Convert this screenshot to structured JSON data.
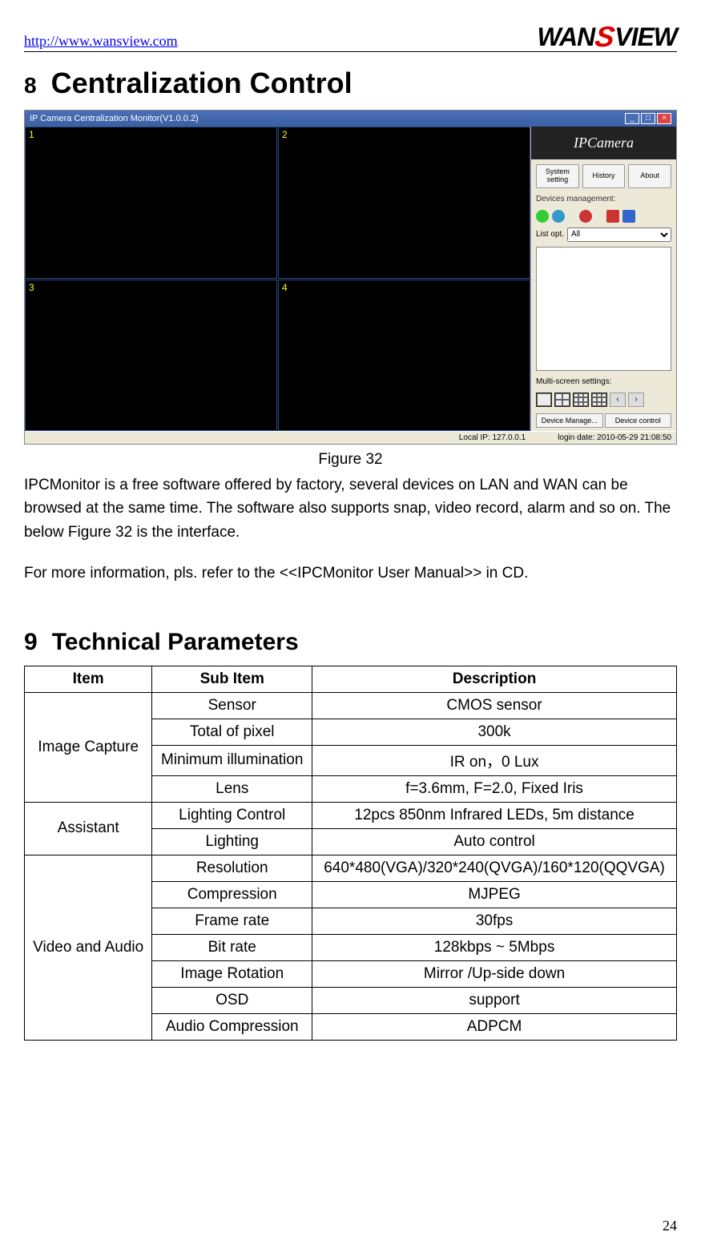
{
  "header": {
    "url": "http://www.wansview.com",
    "logo_text": "WANSVIEW",
    "logo_s": "S"
  },
  "section8": {
    "num": "8",
    "title": "Centralization Control"
  },
  "app": {
    "title": "IP Camera Centralization Monitor(V1.0.0.2)",
    "quad": [
      "1",
      "2",
      "3",
      "4"
    ],
    "right_logo": "IPCamera",
    "tabs": {
      "system": "System setting",
      "history": "History",
      "about": "About"
    },
    "devices_mgmt_label": "Devices management:",
    "list_opt_label": "List opt.",
    "list_opt_value": "All",
    "multi_screen_label": "Multi-screen settings:",
    "device_manage_btn": "Device Manage...",
    "device_control_btn": "Device control",
    "status_ip_label": "Local IP:",
    "status_ip": "127.0.0.1",
    "status_date_label": "login date:",
    "status_date": "2010-05-29 21:08:50"
  },
  "figure_caption": "Figure 32",
  "para1": "IPCMonitor is a free software offered by factory, several devices on LAN and WAN can be browsed at the same time. The software also supports snap, video record, alarm and so on. The below Figure 32 is the interface.",
  "para2": "For more information, pls. refer to the <<IPCMonitor User Manual>> in CD.",
  "section9": {
    "num": "9",
    "title": "Technical Parameters"
  },
  "table": {
    "headers": [
      "Item",
      "Sub Item",
      "Description"
    ],
    "groups": [
      {
        "item": "Image Capture",
        "rows": [
          {
            "sub": "Sensor",
            "desc": "CMOS sensor"
          },
          {
            "sub": "Total of pixel",
            "desc": "300k"
          },
          {
            "sub": "Minimum illumination",
            "desc": "IR on，0 Lux"
          },
          {
            "sub": "Lens",
            "desc": "f=3.6mm, F=2.0, Fixed Iris"
          }
        ]
      },
      {
        "item": "Assistant",
        "rows": [
          {
            "sub": "Lighting Control",
            "desc": "12pcs 850nm Infrared LEDs, 5m distance"
          },
          {
            "sub": "Lighting",
            "desc": "Auto control"
          }
        ]
      },
      {
        "item": "Video and Audio",
        "rows": [
          {
            "sub": "Resolution",
            "desc": "640*480(VGA)/320*240(QVGA)/160*120(QQVGA)"
          },
          {
            "sub": "Compression",
            "desc": "MJPEG"
          },
          {
            "sub": "Frame rate",
            "desc": "30fps"
          },
          {
            "sub": "Bit rate",
            "desc": "128kbps ~ 5Mbps"
          },
          {
            "sub": "Image Rotation",
            "desc": "Mirror /Up-side down"
          },
          {
            "sub": "OSD",
            "desc": "support"
          },
          {
            "sub": "Audio Compression",
            "desc": "ADPCM"
          }
        ]
      }
    ]
  },
  "page_number": "24"
}
